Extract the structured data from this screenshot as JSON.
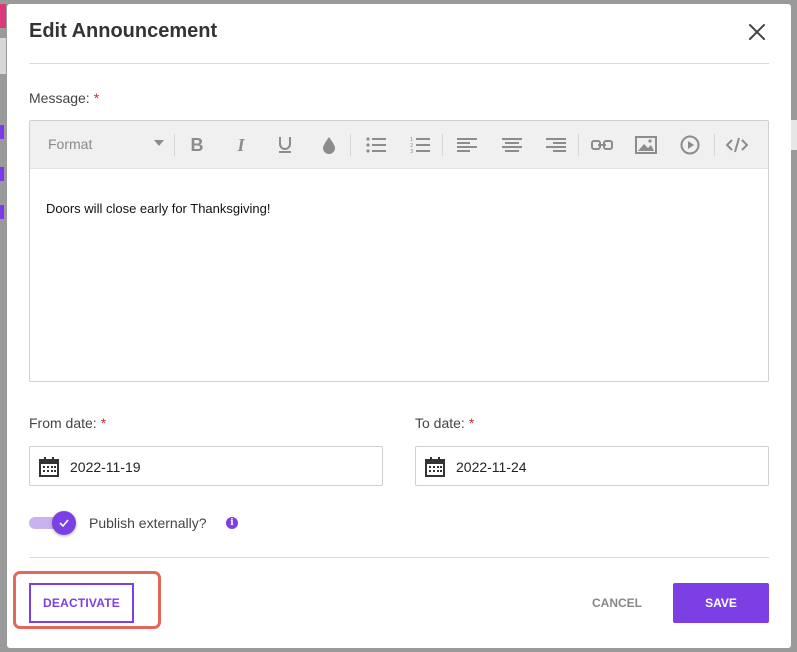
{
  "dialog": {
    "title": "Edit Announcement"
  },
  "message": {
    "label": "Message:",
    "required_mark": "*",
    "format_placeholder": "Format",
    "content": "Doors will close early for Thanksgiving!"
  },
  "toolbar": {
    "buttons": [
      "bold-icon",
      "italic-icon",
      "underline-icon",
      "color-drop-icon",
      "bullet-list-icon",
      "numbered-list-icon",
      "align-left-icon",
      "align-center-icon",
      "align-right-icon",
      "link-icon",
      "image-icon",
      "video-icon",
      "code-view-icon"
    ]
  },
  "from_date": {
    "label": "From date:",
    "required_mark": "*",
    "value": "2022-11-19"
  },
  "to_date": {
    "label": "To date:",
    "required_mark": "*",
    "value": "2022-11-24"
  },
  "publish": {
    "label": "Publish externally?",
    "enabled": true,
    "info_glyph": "i"
  },
  "actions": {
    "deactivate_label": "DEACTIVATE",
    "cancel_label": "CANCEL",
    "save_label": "SAVE"
  },
  "colors": {
    "accent": "#7b3fe4",
    "required": "#d0312d",
    "highlight": "#e3675b"
  }
}
